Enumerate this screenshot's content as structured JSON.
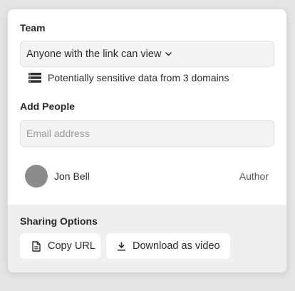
{
  "team": {
    "title": "Team",
    "access_select": {
      "value": "Anyone with the link can view",
      "icon": "chevron-down-icon"
    },
    "notice": {
      "icon": "database-icon",
      "text": "Potentially sensitive data from 3 domains"
    }
  },
  "add_people": {
    "title": "Add People",
    "email_input": {
      "value": "",
      "placeholder": "Email address"
    },
    "members": [
      {
        "name": "Jon Bell",
        "role": "Author",
        "avatar_color": "#8c8c8c"
      }
    ]
  },
  "sharing_options": {
    "title": "Sharing Options",
    "buttons": [
      {
        "label": "Copy URL",
        "icon": "document-icon"
      },
      {
        "label": "Download as video",
        "icon": "download-icon"
      }
    ]
  },
  "colors": {
    "background": "#e4e4e4",
    "panel": "#ffffff",
    "footer": "#efefef",
    "field": "#f3f3f3",
    "text": "#2a2a2a"
  }
}
